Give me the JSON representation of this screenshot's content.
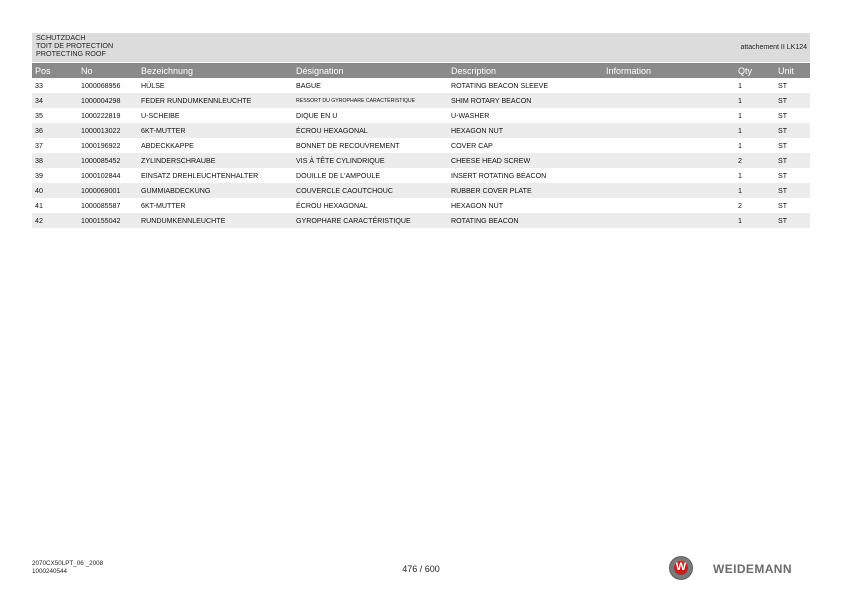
{
  "header": {
    "title_de": "SCHUTZDACH",
    "title_fr": "TOIT DE PROTECTION",
    "title_en": "PROTECTING ROOF",
    "attachment": "attachement II LK124"
  },
  "table": {
    "columns": [
      "Pos",
      "No",
      "Bezeichnung",
      "Désignation",
      "Description",
      "Information",
      "Qty",
      "Unit"
    ],
    "rows": [
      [
        "33",
        "1000068956",
        "HÜLSE",
        "BAGUE",
        "ROTATING BEACON SLEEVE",
        "",
        "1",
        "ST"
      ],
      [
        "34",
        "1000004298",
        "FEDER RUNDUMKENNLEUCHTE",
        "RESSORT DU GYROPHARE CARACTÉRISTIQUE",
        "SHIM ROTARY BEACON",
        "",
        "1",
        "ST"
      ],
      [
        "35",
        "1000222819",
        "U-SCHEIBE",
        "DIQUE EN U",
        "U-WASHER",
        "",
        "1",
        "ST"
      ],
      [
        "36",
        "1000013022",
        "6KT-MUTTER",
        "ÉCROU HEXAGONAL",
        "HEXAGON NUT",
        "",
        "1",
        "ST"
      ],
      [
        "37",
        "1000196922",
        "ABDECKKAPPE",
        "BONNET DE RECOUVREMENT",
        "COVER CAP",
        "",
        "1",
        "ST"
      ],
      [
        "38",
        "1000085452",
        "ZYLINDERSCHRAUBE",
        "VIS À TÊTE CYLINDRIQUE",
        "CHEESE HEAD SCREW",
        "",
        "2",
        "ST"
      ],
      [
        "39",
        "1000102844",
        "EINSATZ DREHLEUCHTENHALTER",
        "DOUILLE DE L'AMPOULE",
        "INSERT ROTATING BEACON",
        "",
        "1",
        "ST"
      ],
      [
        "40",
        "1000069001",
        "GUMMIABDECKUNG",
        "COUVERCLE CAOUTCHOUC",
        "RUBBER COVER PLATE",
        "",
        "1",
        "ST"
      ],
      [
        "41",
        "1000085587",
        "6KT-MUTTER",
        "ÉCROU HEXAGONAL",
        "HEXAGON NUT",
        "",
        "2",
        "ST"
      ],
      [
        "42",
        "1000155042",
        "RUNDUMKENNLEUCHTE",
        "GYROPHARE CARACTÉRISTIQUE",
        "ROTATING BEACON",
        "",
        "1",
        "ST"
      ]
    ]
  },
  "footer": {
    "doc_code": "2070CX50LPT_06 _2008",
    "doc_number": "1000240544",
    "page": "476 / 600",
    "brand": "WEIDEMANN",
    "logo_letter": "W"
  },
  "colors": {
    "header_band": "#dcdcdc",
    "column_header": "#8a8a8a",
    "row_stripe": "#ececec",
    "logo_red": "#c8201e",
    "logo_grey": "#6b6b6b"
  }
}
